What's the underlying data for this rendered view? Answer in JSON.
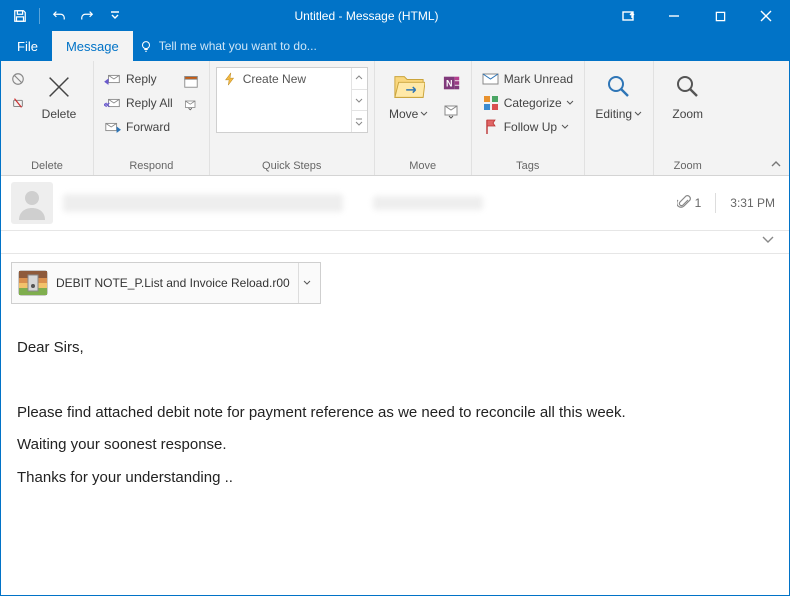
{
  "window_title": "Untitled - Message (HTML)",
  "tabs": {
    "file": "File",
    "message": "Message",
    "tell_me": "Tell me what you want to do..."
  },
  "ribbon": {
    "delete": {
      "label": "Delete",
      "group": "Delete"
    },
    "respond": {
      "reply": "Reply",
      "reply_all": "Reply All",
      "forward": "Forward",
      "group": "Respond"
    },
    "quick_steps": {
      "create_new": "Create New",
      "group": "Quick Steps"
    },
    "move": {
      "move": "Move",
      "group": "Move"
    },
    "tags": {
      "mark_unread": "Mark Unread",
      "categorize": "Categorize",
      "follow_up": "Follow Up",
      "group": "Tags"
    },
    "editing": {
      "label": "Editing"
    },
    "zoom": {
      "label": "Zoom",
      "group": "Zoom"
    }
  },
  "header": {
    "attachment_count": "1",
    "time": "3:31 PM"
  },
  "attachment": {
    "filename": "DEBIT NOTE_P.List and Invoice Reload.r00"
  },
  "body": {
    "greeting": "Dear Sirs,",
    "line1": "Please find attached debit note for payment reference as we need to reconcile all this week.",
    "line2": "Waiting your soonest response.",
    "line3": "Thanks for your understanding .."
  }
}
